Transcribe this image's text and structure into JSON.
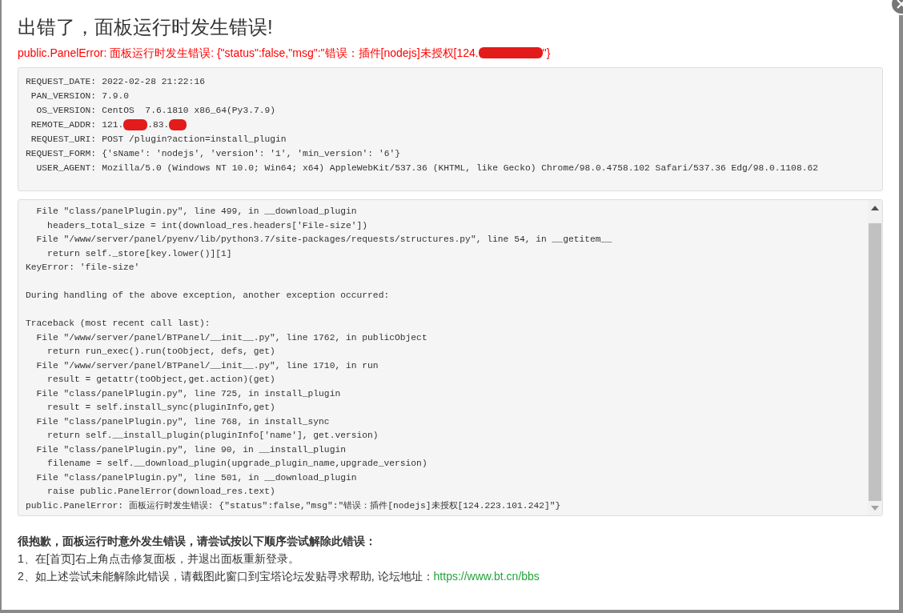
{
  "dialog": {
    "title": "出错了，面板运行时发生错误!",
    "error_before_redaction": "public.PanelError: 面板运行时发生错误: {\"status\":false,\"msg\":\"错误：插件[nodejs]未授权[124.",
    "error_after_redaction": "\"}"
  },
  "request_info": [
    {
      "label": "REQUEST_DATE:",
      "parts": [
        "2022-02-28 21:22:16"
      ]
    },
    {
      "label": "PAN_VERSION:",
      "parts": [
        "7.9.0"
      ]
    },
    {
      "label": "OS_VERSION:",
      "parts": [
        "CentOS  7.6.1810 x86_64(Py3.7.9)"
      ]
    },
    {
      "label": "REMOTE_ADDR:",
      "parts": [
        "121.",
        {
          "kind": "redaction"
        },
        ".83.",
        {
          "kind": "redaction"
        }
      ]
    },
    {
      "label": "REQUEST_URI:",
      "parts": [
        "POST /plugin?action=install_plugin"
      ]
    },
    {
      "label": "REQUEST_FORM:",
      "parts": [
        "{'sName': 'nodejs', 'version': '1', 'min_version': '6'}"
      ]
    },
    {
      "label": "USER_AGENT:",
      "parts": [
        "Mozilla/5.0 (Windows NT 10.0; Win64; x64) AppleWebKit/537.36 (KHTML, like Gecko) Chrome/98.0.4758.102 Safari/537.36 Edg/98.0.1108.62"
      ]
    }
  ],
  "traceback": [
    "  File \"class/panelPlugin.py\", line 499, in __download_plugin",
    "    headers_total_size = int(download_res.headers['File-size'])",
    "  File \"/www/server/panel/pyenv/lib/python3.7/site-packages/requests/structures.py\", line 54, in __getitem__",
    "    return self._store[key.lower()][1]",
    "KeyError: 'file-size'",
    {
      "kind": "blank"
    },
    "During handling of the above exception, another exception occurred:",
    {
      "kind": "blank"
    },
    "Traceback (most recent call last):",
    "  File \"/www/server/panel/BTPanel/__init__.py\", line 1762, in publicObject",
    "    return run_exec().run(toObject, defs, get)",
    "  File \"/www/server/panel/BTPanel/__init__.py\", line 1710, in run",
    "    result = getattr(toObject,get.action)(get)",
    "  File \"class/panelPlugin.py\", line 725, in install_plugin",
    "    result = self.install_sync(pluginInfo,get)",
    "  File \"class/panelPlugin.py\", line 768, in install_sync",
    "    return self.__install_plugin(pluginInfo['name'], get.version)",
    "  File \"class/panelPlugin.py\", line 90, in __install_plugin",
    "    filename = self.__download_plugin(upgrade_plugin_name,upgrade_version)",
    "  File \"class/panelPlugin.py\", line 501, in __download_plugin",
    "    raise public.PanelError(download_res.text)",
    "public.PanelError: 面板运行时发生错误: {\"status\":false,\"msg\":\"错误：插件[nodejs]未授权[124.223.101.242]\"}"
  ],
  "help": {
    "heading": "很抱歉，面板运行时意外发生错误，请尝试按以下顺序尝试解除此错误：",
    "steps": [
      {
        "text": "1、在[首页]右上角点击修复面板，并退出面板重新登录。"
      },
      {
        "text": "2、如上述尝试未能解除此错误，请截图此窗口到宝塔论坛发贴寻求帮助, 论坛地址：",
        "link": "https://www.bt.cn/bbs"
      }
    ]
  }
}
